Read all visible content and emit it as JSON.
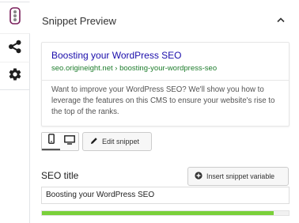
{
  "sidebar": {
    "tabs": [
      {
        "name": "readability",
        "icon": "traffic-light-icon"
      },
      {
        "name": "social",
        "icon": "share-icon"
      },
      {
        "name": "settings",
        "icon": "gear-icon"
      }
    ]
  },
  "panel": {
    "title": "Snippet Preview",
    "collapse_icon": "chevron-up-icon"
  },
  "preview": {
    "title": "Boosting your WordPress SEO",
    "url": "seo.origineight.net › boosting-your-wordpress-seo",
    "description": "Want to improve your WordPress SEO? We'll show you how to leverage the features on this CMS to ensure your website's rise to the top of the ranks.",
    "title_color": "#1a0dab",
    "url_color": "#1e7d2d"
  },
  "controls": {
    "mobile_icon": "mobile-icon",
    "desktop_icon": "desktop-icon",
    "edit_label": "Edit snippet",
    "edit_icon": "pencil-icon"
  },
  "seo_title": {
    "label": "SEO title",
    "insert_label": "Insert snippet variable",
    "insert_icon": "plus-circle-icon",
    "value": "Boosting your WordPress SEO",
    "progress": 0.94,
    "progress_color": "#7ad03a"
  }
}
